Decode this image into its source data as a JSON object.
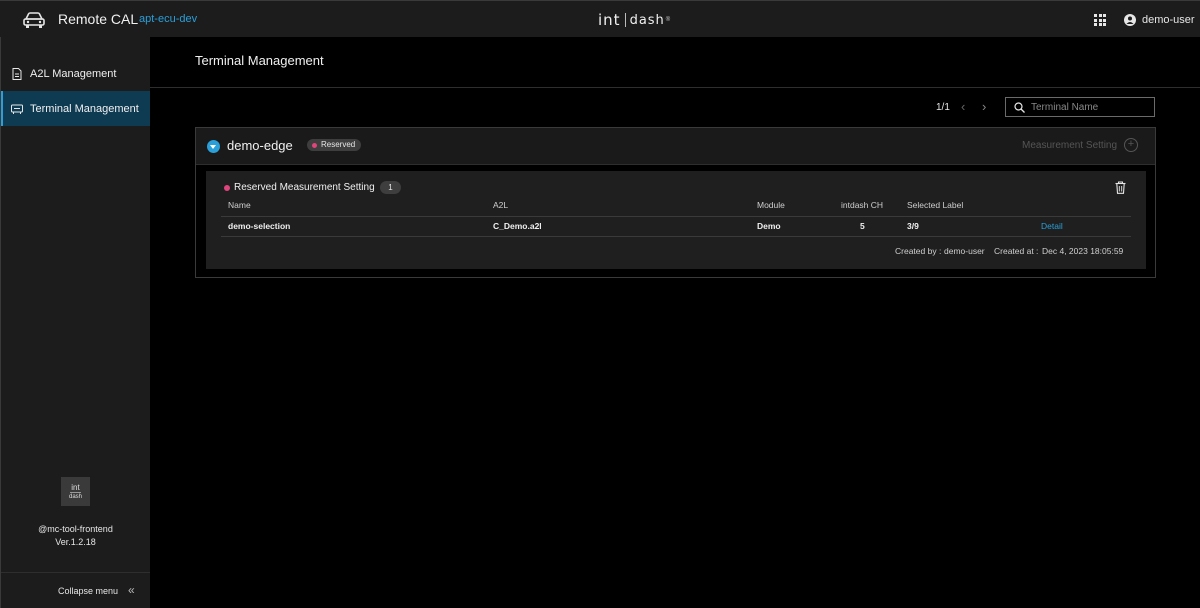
{
  "app": {
    "title": "Remote CAL",
    "environment": "apt-ecu-dev",
    "brand_left": "int",
    "brand_right": "dash",
    "brand_mark": "®",
    "user": "demo-user"
  },
  "sidebar": {
    "items": [
      {
        "label": "A2L Management",
        "icon": "document-icon",
        "active": false
      },
      {
        "label": "Terminal Management",
        "icon": "terminal-icon",
        "active": true
      }
    ],
    "logo_top": "int",
    "logo_bottom": "dash",
    "package": "@mc-tool-frontend",
    "version": "Ver.1.2.18",
    "collapse_label": "Collapse menu",
    "collapse_icon": "«"
  },
  "main": {
    "title": "Terminal Management",
    "pagination": {
      "text": "1/1",
      "prev": "‹",
      "next": "›"
    },
    "search": {
      "placeholder": "Terminal Name",
      "value": ""
    },
    "terminal": {
      "name": "demo-edge",
      "status": "Reserved",
      "status_color": "#e0447c",
      "add_setting_label": "Measurement Setting",
      "add_icon": "+",
      "setting": {
        "title": "Reserved Measurement Setting",
        "count": "1",
        "columns": [
          "Name",
          "A2L",
          "Module",
          "intdash CH",
          "Selected Label"
        ],
        "rows": [
          {
            "name": "demo-selection",
            "a2l": "C_Demo.a2l",
            "module": "Demo",
            "ch": "5",
            "selected_label": "3/9",
            "action": "Detail"
          }
        ],
        "created_by_label": "Created by :",
        "created_by": "demo-user",
        "created_at_label": "Created at :",
        "created_at": "Dec 4, 2023 18:05:59"
      }
    }
  },
  "colors": {
    "accent": "#2a9fd8",
    "reserved": "#e0447c",
    "background": "#000000",
    "panel": "#1c1c1c"
  }
}
